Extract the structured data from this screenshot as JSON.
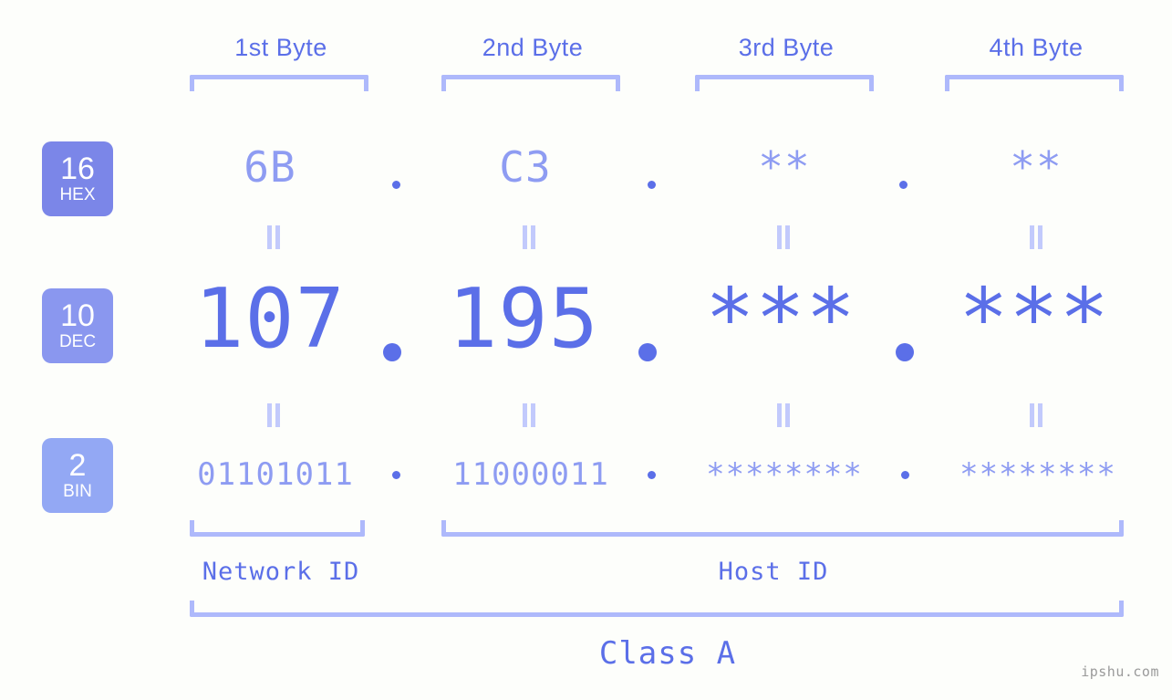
{
  "headers": [
    {
      "label": "1st Byte"
    },
    {
      "label": "2nd Byte"
    },
    {
      "label": "3rd Byte"
    },
    {
      "label": "4th Byte"
    }
  ],
  "bases": [
    {
      "num": "16",
      "abbr": "HEX",
      "color": "#7b86e8"
    },
    {
      "num": "10",
      "abbr": "DEC",
      "color": "#8a97ef"
    },
    {
      "num": "2",
      "abbr": "BIN",
      "color": "#93a8f4"
    }
  ],
  "rows": {
    "hex": {
      "values": [
        "6B",
        "C3",
        "**",
        "**"
      ]
    },
    "dec": {
      "values": [
        "107",
        "195",
        "***",
        "***"
      ]
    },
    "bin": {
      "values": [
        "01101011",
        "11000011",
        "********",
        "********"
      ]
    }
  },
  "separator": ".",
  "segments": {
    "network_id": "Network ID",
    "host_id": "Host ID"
  },
  "class_label": "Class A",
  "watermark": "ipshu.com",
  "colors": {
    "background": "#fdfefb",
    "accent_strong": "#5b6fe8",
    "accent_mid": "#8e9cf2",
    "accent_light": "#aeb9fb",
    "connector": "#c2cafc",
    "watermark": "#9a9a9a"
  }
}
